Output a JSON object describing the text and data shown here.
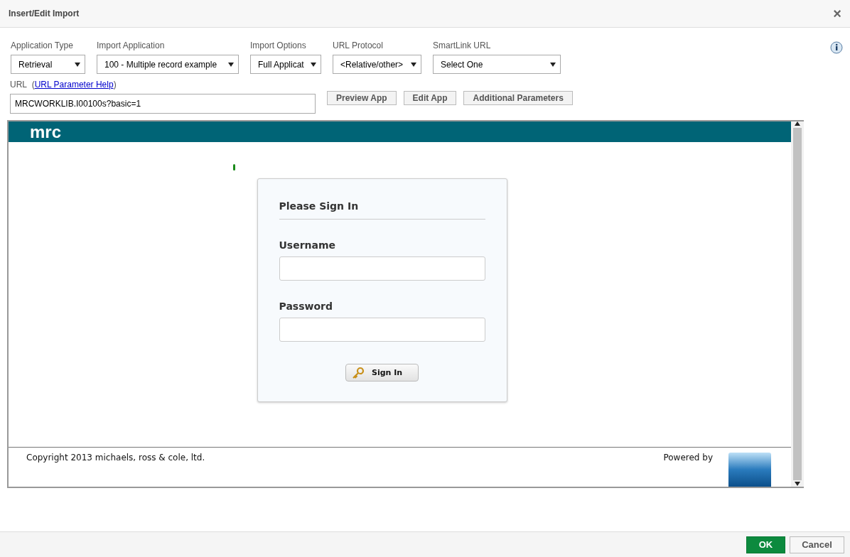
{
  "window": {
    "title": "Insert/Edit Import",
    "close": "×"
  },
  "selects": [
    {
      "label": "Application Type",
      "value": "Retrieval"
    },
    {
      "label": "Import Application",
      "value": "100 - Multiple record example"
    },
    {
      "label": "Import Options",
      "value": "Full Applicat"
    },
    {
      "label": "URL Protocol",
      "value": "<Relative/other>"
    },
    {
      "label": "SmartLink URL",
      "value": "Select One"
    }
  ],
  "url": {
    "label": "URL",
    "open": "(",
    "link": "URL Parameter Help",
    "close": ")",
    "value": "MRCWORKLIB.I00100s?basic=1"
  },
  "buttons": [
    "Preview App",
    "Edit App",
    "Additional Parameters"
  ],
  "preview": {
    "logo": "mrc",
    "title": "Please Sign In",
    "fields": [
      {
        "label": "Username"
      },
      {
        "label": "Password"
      }
    ],
    "submit": "Sign In",
    "copyright": "Copyright 2013 michaels, ross & cole, ltd.",
    "powered": "Powered by"
  },
  "footer": {
    "ok": "OK",
    "cancel": "Cancel"
  }
}
